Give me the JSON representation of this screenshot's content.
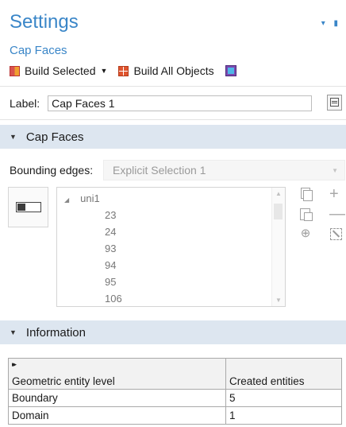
{
  "window": {
    "title": "Settings",
    "pin_glyph": "▾ ▮"
  },
  "node": {
    "name": "Cap Faces"
  },
  "toolbar": {
    "build_selected_label": "Build Selected",
    "build_selected_caret": "▼",
    "build_all_label": "Build All Objects"
  },
  "label_field": {
    "label": "Label:",
    "value": "Cap Faces 1"
  },
  "sections": {
    "cap_faces": {
      "title": "Cap Faces",
      "expand_glyph": "▼"
    },
    "information": {
      "title": "Information",
      "expand_glyph": "▼"
    }
  },
  "bounding_edges": {
    "label": "Bounding edges:",
    "selected": "Explicit Selection 1",
    "dropdown_glyph": "▼"
  },
  "selection_list": {
    "root_expander": "◢",
    "root": "uni1",
    "items": [
      "23",
      "24",
      "93",
      "94",
      "95",
      "106"
    ]
  },
  "side_tools": {
    "zoom_glyph": "⊕",
    "add_glyph": "+",
    "remove_glyph": "—"
  },
  "info_table": {
    "sort_glyph": "▸▸",
    "headers": [
      "Geometric entity level",
      "Created entities"
    ],
    "rows": [
      [
        "Boundary",
        "5"
      ],
      [
        "Domain",
        "1"
      ]
    ]
  },
  "colors": {
    "accent": "#3a86c8",
    "section_bg": "#dde6f0"
  }
}
